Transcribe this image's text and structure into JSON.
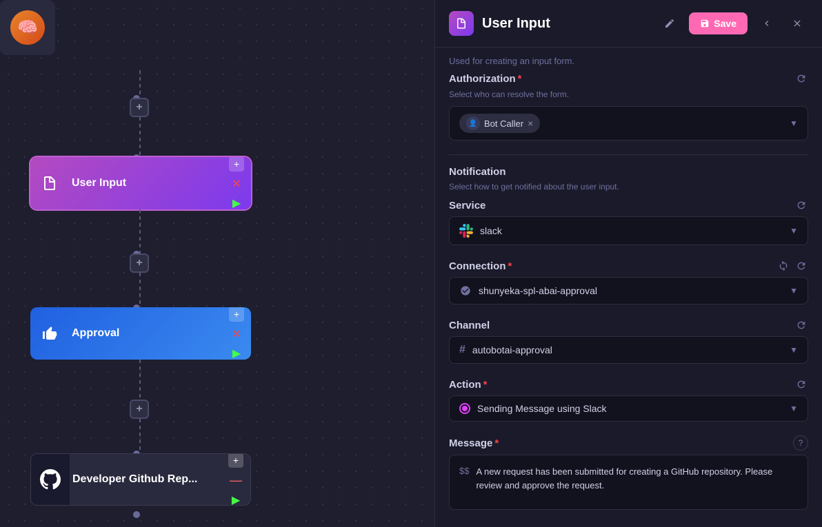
{
  "canvas": {
    "nodes": [
      {
        "id": "brain",
        "label": "",
        "type": "brain",
        "icon": "🧠"
      },
      {
        "id": "user-input",
        "label": "User Input",
        "type": "user-input",
        "selected": true
      },
      {
        "id": "approval",
        "label": "Approval",
        "type": "approval"
      },
      {
        "id": "github",
        "label": "Developer Github Rep...",
        "type": "github"
      }
    ],
    "plus_buttons": [
      "+",
      "+",
      "+"
    ]
  },
  "panel": {
    "title": "User Input",
    "subtitle": "Used for creating an input form.",
    "save_label": "Save",
    "edit_tooltip": "Edit",
    "collapse_tooltip": "Collapse",
    "close_tooltip": "Close",
    "sections": {
      "authorization": {
        "title": "Authorization",
        "required": true,
        "description": "Select who can resolve the form.",
        "value": "Bot Caller",
        "tag_remove": "×"
      },
      "notification": {
        "title": "Notification",
        "description": "Select how to get notified about the user input.",
        "service": {
          "title": "Service",
          "value": "slack"
        },
        "connection": {
          "title": "Connection",
          "required": true,
          "value": "shunyeka-spl-abai-approval"
        },
        "channel": {
          "title": "Channel",
          "value": "autobotai-approval"
        },
        "action": {
          "title": "Action",
          "required": true,
          "value": "Sending Message using Slack"
        },
        "message": {
          "title": "Message",
          "required": true,
          "prefix": "$$",
          "value": "A new request has been submitted for creating a GitHub repository. Please review and approve the request."
        }
      }
    }
  }
}
